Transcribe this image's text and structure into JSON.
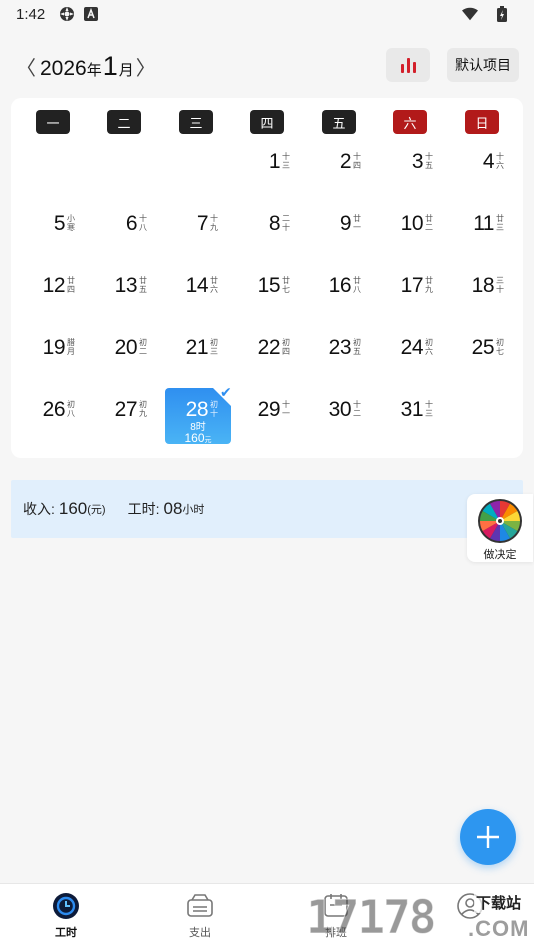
{
  "status_bar": {
    "time": "1:42"
  },
  "header": {
    "prev_arrow": "〈",
    "next_arrow": "〉",
    "year": "2026",
    "year_unit": "年",
    "month": "1",
    "month_unit": "月",
    "default_project_label": "默认项目"
  },
  "weekdays": [
    "一",
    "二",
    "三",
    "四",
    "五",
    "六",
    "日"
  ],
  "days": [
    {
      "num": "1",
      "lunar": "十三"
    },
    {
      "num": "2",
      "lunar": "十四"
    },
    {
      "num": "3",
      "lunar": "十五"
    },
    {
      "num": "4",
      "lunar": "十六"
    },
    {
      "num": "5",
      "lunar": "小寒"
    },
    {
      "num": "6",
      "lunar": "十八"
    },
    {
      "num": "7",
      "lunar": "十九"
    },
    {
      "num": "8",
      "lunar": "二十"
    },
    {
      "num": "9",
      "lunar": "廿一"
    },
    {
      "num": "10",
      "lunar": "廿二"
    },
    {
      "num": "11",
      "lunar": "廿三"
    },
    {
      "num": "12",
      "lunar": "廿四"
    },
    {
      "num": "13",
      "lunar": "廿五"
    },
    {
      "num": "14",
      "lunar": "廿六"
    },
    {
      "num": "15",
      "lunar": "廿七"
    },
    {
      "num": "16",
      "lunar": "廿八"
    },
    {
      "num": "17",
      "lunar": "廿九"
    },
    {
      "num": "18",
      "lunar": "三十"
    },
    {
      "num": "19",
      "lunar": "腊月"
    },
    {
      "num": "20",
      "lunar": "初二"
    },
    {
      "num": "21",
      "lunar": "初三"
    },
    {
      "num": "22",
      "lunar": "初四"
    },
    {
      "num": "23",
      "lunar": "初五"
    },
    {
      "num": "24",
      "lunar": "初六"
    },
    {
      "num": "25",
      "lunar": "初七"
    },
    {
      "num": "26",
      "lunar": "初八"
    },
    {
      "num": "27",
      "lunar": "初九"
    },
    {
      "num": "28",
      "lunar": "初十",
      "selected": true,
      "hours": "8时",
      "pay": "160",
      "pay_unit": "元"
    },
    {
      "num": "29",
      "lunar": "十一"
    },
    {
      "num": "30",
      "lunar": "十二"
    },
    {
      "num": "31",
      "lunar": "十三"
    }
  ],
  "summary": {
    "income_label": "收入:",
    "income_value": "160",
    "income_unit": "(元)",
    "hours_label": "工时:",
    "hours_value": "08",
    "hours_unit": "小时"
  },
  "decide_label": "做决定",
  "nav": {
    "worktime": "工时",
    "expense": "支出",
    "schedule": "排班"
  },
  "watermark": {
    "digits": "17178",
    "site": "下载站",
    "com": ".COM"
  },
  "colors": {
    "weekday_bg": "#222222",
    "weekend_bg": "#b21a1a",
    "selected_bg": "#2f8ff0",
    "summary_bg": "#e1effc",
    "fab": "#2d96f0",
    "stats_bars": "#d3202b"
  },
  "icons": {
    "status": [
      "settings-gear-icon",
      "font-a-icon",
      "wifi-icon",
      "battery-charging-icon"
    ],
    "header": [
      "bar-chart-icon"
    ],
    "fab": "plus-icon",
    "decide": "color-wheel-icon",
    "nav": [
      "clock-icon",
      "wallet-icon",
      "schedule-icon",
      "profile-icon"
    ]
  }
}
